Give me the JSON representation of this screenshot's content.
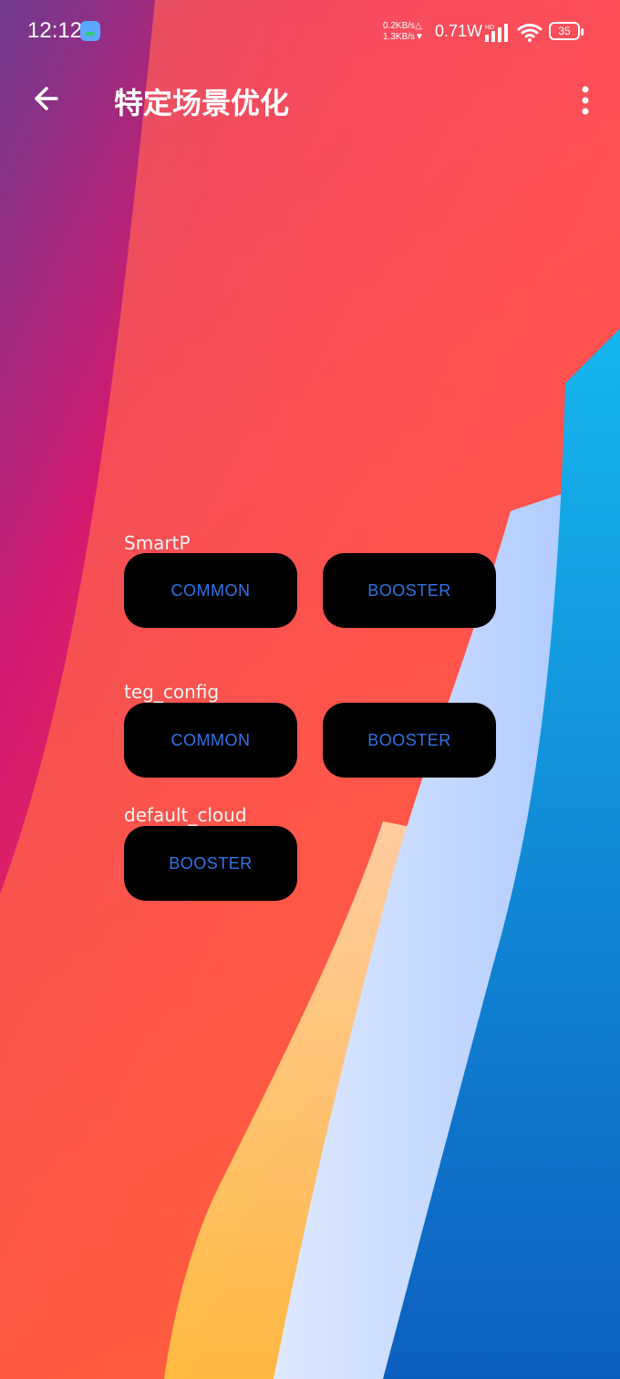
{
  "status_bar": {
    "time": "12:12",
    "net_up": "0.2KB/s△",
    "net_down": "1.3KB/s▼",
    "power": "0.71W",
    "battery": "35"
  },
  "app_bar": {
    "title": "特定场景优化"
  },
  "groups": [
    {
      "label": "SmartP",
      "buttons": [
        "COMMON",
        "BOOSTER"
      ]
    },
    {
      "label": "teg_config",
      "buttons": [
        "COMMON",
        "BOOSTER"
      ]
    },
    {
      "label": "default_cloud",
      "buttons": [
        "BOOSTER"
      ]
    }
  ],
  "icons": {
    "back": "arrow-left-icon",
    "more": "more-vert-icon",
    "signal": "signal-icon",
    "wifi": "wifi-icon"
  },
  "colors": {
    "button_bg": "#000000",
    "button_text": "#2f74e8"
  }
}
